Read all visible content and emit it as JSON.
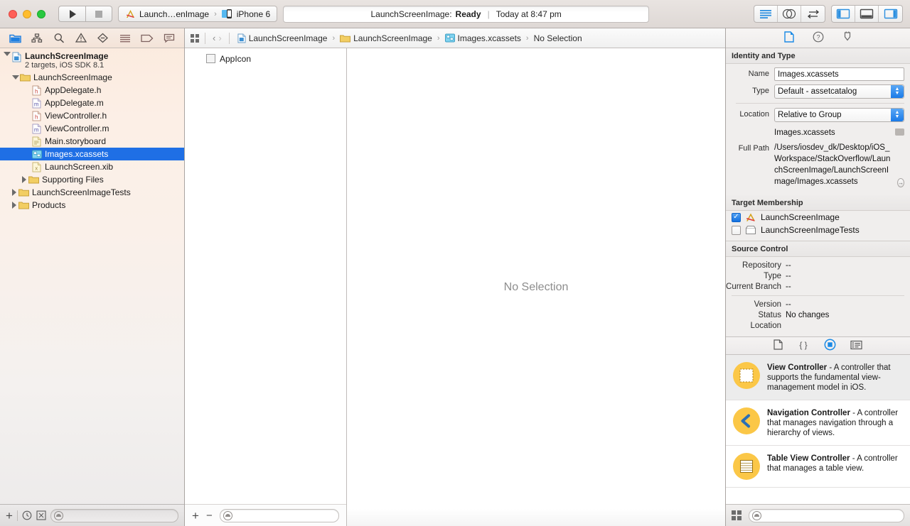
{
  "window": {
    "traffic_lights": [
      "close",
      "minimize",
      "zoom"
    ]
  },
  "toolbar": {
    "run_label": "Run",
    "stop_label": "Stop",
    "scheme_name": "Launch…enImage",
    "destination": "iPhone 6",
    "status_project": "LaunchScreenImage:",
    "status_state": "Ready",
    "status_separator": "|",
    "status_time": "Today at 8:47 pm",
    "editor_segments": [
      "standard-editor",
      "assistant-editor",
      "version-editor"
    ],
    "view_segments": [
      "toggle-navigator",
      "toggle-debug-area",
      "toggle-utilities"
    ]
  },
  "navigator": {
    "tabs": [
      "project-navigator",
      "symbol-navigator",
      "find-navigator",
      "issue-navigator",
      "test-navigator",
      "debug-navigator",
      "breakpoint-navigator",
      "report-navigator"
    ],
    "tree": [
      {
        "label": "LaunchScreenImage",
        "sublabel": "2 targets, iOS SDK 8.1",
        "icon": "project-icon",
        "depth": 0,
        "disclosure": "down",
        "selected": false,
        "type": "project"
      },
      {
        "label": "LaunchScreenImage",
        "icon": "folder-icon",
        "depth": 1,
        "disclosure": "down",
        "selected": false,
        "type": "group"
      },
      {
        "label": "AppDelegate.h",
        "icon": "header-file-icon",
        "depth": 2,
        "disclosure": "none",
        "selected": false,
        "type": "h"
      },
      {
        "label": "AppDelegate.m",
        "icon": "objc-file-icon",
        "depth": 2,
        "disclosure": "none",
        "selected": false,
        "type": "m"
      },
      {
        "label": "ViewController.h",
        "icon": "header-file-icon",
        "depth": 2,
        "disclosure": "none",
        "selected": false,
        "type": "h"
      },
      {
        "label": "ViewController.m",
        "icon": "objc-file-icon",
        "depth": 2,
        "disclosure": "none",
        "selected": false,
        "type": "m"
      },
      {
        "label": "Main.storyboard",
        "icon": "storyboard-file-icon",
        "depth": 2,
        "disclosure": "none",
        "selected": false,
        "type": "storyboard"
      },
      {
        "label": "Images.xcassets",
        "icon": "assetcatalog-icon",
        "depth": 2,
        "disclosure": "none",
        "selected": true,
        "type": "xcassets"
      },
      {
        "label": "LaunchScreen.xib",
        "icon": "xib-file-icon",
        "depth": 2,
        "disclosure": "none",
        "selected": false,
        "type": "xib"
      },
      {
        "label": "Supporting Files",
        "icon": "folder-icon",
        "depth": 2,
        "disclosure": "right",
        "selected": false,
        "type": "group"
      },
      {
        "label": "LaunchScreenImageTests",
        "icon": "folder-icon",
        "depth": 1,
        "disclosure": "right",
        "selected": false,
        "type": "group"
      },
      {
        "label": "Products",
        "icon": "folder-icon",
        "depth": 1,
        "disclosure": "right",
        "selected": false,
        "type": "group"
      }
    ],
    "bottom": {
      "add_label": "+",
      "filter_placeholder": ""
    }
  },
  "breadcrumb": {
    "back_arrow": "‹",
    "forward_arrow": "›",
    "items": [
      {
        "label": "LaunchScreenImage",
        "icon": "project-icon"
      },
      {
        "label": "LaunchScreenImage",
        "icon": "folder-icon"
      },
      {
        "label": "Images.xcassets",
        "icon": "assetcatalog-icon"
      },
      {
        "label": "No Selection",
        "icon": "none"
      }
    ]
  },
  "asset_catalog": {
    "items": [
      {
        "label": "AppIcon",
        "icon": "appicon-thumb"
      }
    ],
    "bottom": {
      "add_label": "+",
      "remove_label": "−",
      "filter_placeholder": ""
    }
  },
  "canvas": {
    "empty_message": "No Selection"
  },
  "inspector": {
    "tabs": [
      "file-inspector",
      "quick-help-inspector",
      "hidden-inspector"
    ],
    "identity_and_type": {
      "title": "Identity and Type",
      "name_label": "Name",
      "name_value": "Images.xcassets",
      "type_label": "Type",
      "type_value": "Default - assetcatalog",
      "location_label": "Location",
      "location_value": "Relative to Group",
      "location_file": "Images.xcassets",
      "full_path_label": "Full Path",
      "full_path_value": "/Users/iosdev_dk/Desktop/iOS_Workspace/StackOverflow/LaunchScreenImage/LaunchScreenImage/Images.xcassets"
    },
    "target_membership": {
      "title": "Target Membership",
      "targets": [
        {
          "label": "LaunchScreenImage",
          "checked": true,
          "icon": "app-target-icon"
        },
        {
          "label": "LaunchScreenImageTests",
          "checked": false,
          "icon": "test-target-icon"
        }
      ]
    },
    "source_control": {
      "title": "Source Control",
      "rows": [
        {
          "label": "Repository",
          "value": "--"
        },
        {
          "label": "Type",
          "value": "--"
        },
        {
          "label": "Current Branch",
          "value": "--"
        }
      ],
      "rows2": [
        {
          "label": "Version",
          "value": "--"
        },
        {
          "label": "Status",
          "value": "No changes"
        },
        {
          "label": "Location",
          "value": ""
        }
      ]
    }
  },
  "library": {
    "tabs": [
      "file-template-library",
      "code-snippet-library",
      "object-library",
      "media-library"
    ],
    "active_tab": "object-library",
    "items": [
      {
        "title": "View Controller",
        "description": " - A controller that supports the fundamental view-management model in iOS.",
        "icon": "view-controller-icon",
        "selected": true
      },
      {
        "title": "Navigation Controller",
        "description": " - A controller that manages navigation through a hierarchy of views.",
        "icon": "navigation-controller-icon",
        "selected": false
      },
      {
        "title": "Table View Controller",
        "description": " - A controller that manages a table view.",
        "icon": "table-view-controller-icon",
        "selected": false
      }
    ],
    "bottom": {
      "filter_placeholder": ""
    }
  },
  "colors": {
    "selection_blue": "#1f6fe5",
    "accent_blue": "#1a7ae8",
    "library_icon_yellow": "#fbc747",
    "folder_yellow": "#f2c94c"
  }
}
